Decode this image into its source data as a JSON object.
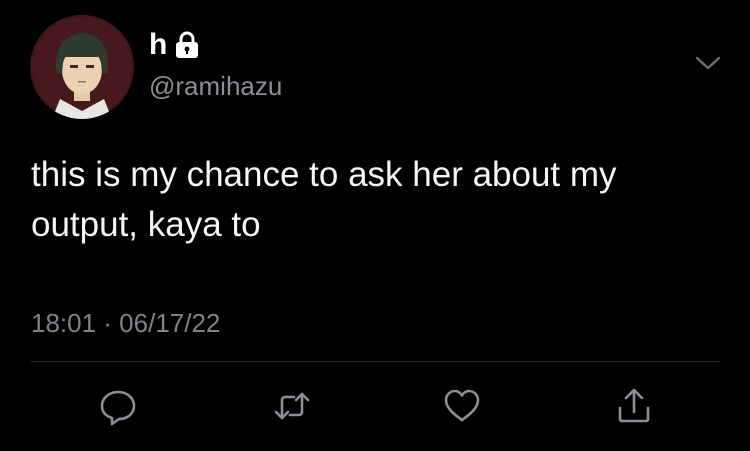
{
  "user": {
    "display_name": "h",
    "handle": "@ramihazu",
    "protected_icon": "lock-icon",
    "avatar": "avatar"
  },
  "tweet": {
    "text": "this is my chance to ask her about my output, kaya to",
    "timestamp": "18:01 · 06/17/22"
  },
  "actions": [
    {
      "name": "reply",
      "icon": "speech-bubble-icon"
    },
    {
      "name": "retweet",
      "icon": "retweet-icon"
    },
    {
      "name": "like",
      "icon": "heart-icon"
    },
    {
      "name": "share",
      "icon": "share-icon"
    }
  ],
  "menu_icon": "chevron-down-icon",
  "colors": {
    "background": "#000000",
    "text": "#ffffff",
    "secondary_text": "#8b9096",
    "divider": "#2b2e31",
    "icon": "#8b9096"
  }
}
